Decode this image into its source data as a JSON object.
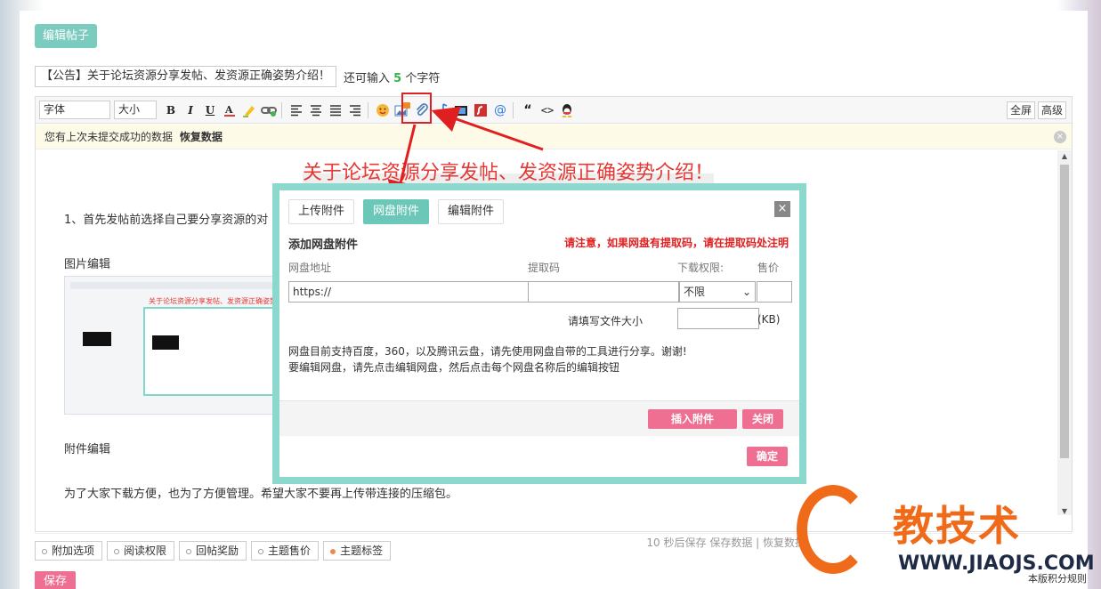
{
  "edit_tab": "编辑帖子",
  "title": {
    "value": "【公告】关于论坛资源分享发帖、发资源正确姿势介绍！",
    "remain_prefix": "还可输入",
    "remain_count": "5",
    "remain_suffix": "个字符"
  },
  "toolbar": {
    "font": "字体",
    "size": "大小",
    "bold": "B",
    "italic": "I",
    "underline": "U",
    "fullscreen": "全屏",
    "advanced": "高级"
  },
  "notice": {
    "text": "您有上次未提交成功的数据",
    "link": "恢复数据",
    "close": "×"
  },
  "content": {
    "heading": "关于论坛资源分享发帖、发资源正确姿势介绍！",
    "step1": "1、首先发帖前选择自己要分享资源的对",
    "image_edit": "图片编辑",
    "attach_edit": "附件编辑",
    "bottom_text": "为了大家下载方便，也为了方便管理。希望大家不要再上传带连接的压缩包。",
    "thumb_caption": "关于论坛资源分享发帖、发资源正确姿势介绍！"
  },
  "save_status": "10 秒后保存 保存数据 | 恢复数据",
  "options": [
    "附加选项",
    "阅读权限",
    "回帖奖励",
    "主题售价",
    "主题标签"
  ],
  "save_button": "保存",
  "dialog": {
    "tabs": [
      "上传附件",
      "网盘附件",
      "编辑附件"
    ],
    "close": "×",
    "heading": "添加网盘附件",
    "warning": "请注意，如果网盘有提取码，请在提取码处注明",
    "col_url": "网盘地址",
    "col_code": "提取码",
    "col_perm": "下载权限:",
    "col_price": "售价",
    "url_value": "https://",
    "perm_value": "不限",
    "size_label": "请填写文件大小",
    "kb": "(KB)",
    "desc1": "网盘目前支持百度，360，以及腾讯云盘，请先使用网盘自带的工具进行分享。谢谢!",
    "desc2": "要编辑网盘，请先点击编辑网盘，然后点击每个网盘名称后的编辑按钮",
    "insert": "插入附件",
    "close_btn": "关闭",
    "confirm": "确定"
  },
  "watermark": {
    "brand": "教技术",
    "url": "WWW.JIAOJS.COM",
    "copyright": "本版积分规则"
  },
  "colors": {
    "accent": "#7ccbbf",
    "pink": "#ef6f93",
    "red": "#e02020",
    "orange": "#ef6b19"
  }
}
